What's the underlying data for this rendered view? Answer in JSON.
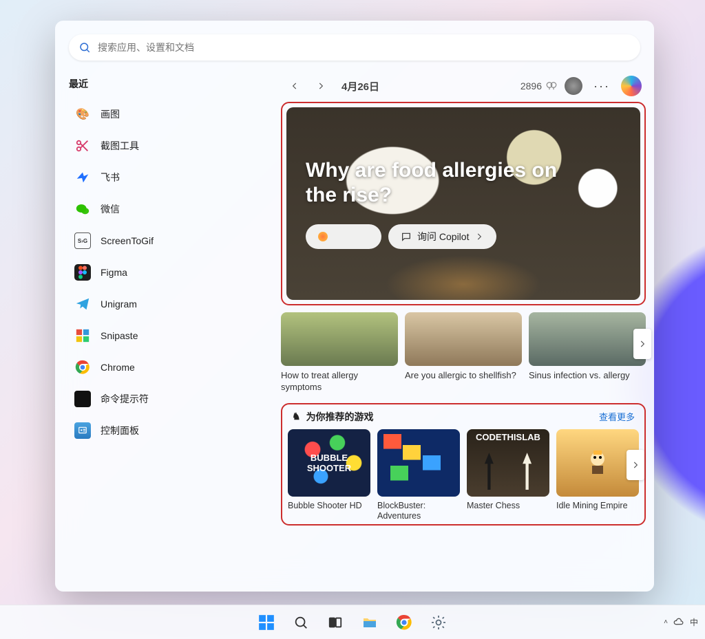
{
  "search": {
    "placeholder": "搜索应用、设置和文档"
  },
  "sidebar": {
    "section_title": "最近",
    "items": [
      {
        "label": "画图",
        "icon": "paint-icon"
      },
      {
        "label": "截图工具",
        "icon": "snip-icon"
      },
      {
        "label": "飞书",
        "icon": "feishu-icon"
      },
      {
        "label": "微信",
        "icon": "wechat-icon"
      },
      {
        "label": "ScreenToGif",
        "icon": "screentogif-icon"
      },
      {
        "label": "Figma",
        "icon": "figma-icon"
      },
      {
        "label": "Unigram",
        "icon": "unigram-icon"
      },
      {
        "label": "Snipaste",
        "icon": "snipaste-icon"
      },
      {
        "label": "Chrome",
        "icon": "chrome-icon"
      },
      {
        "label": "命令提示符",
        "icon": "cmd-icon"
      },
      {
        "label": "控制面板",
        "icon": "controlpanel-icon"
      }
    ]
  },
  "feed": {
    "date": "4月26日",
    "points": "2896",
    "hero": {
      "title": "Why are food allergies on the rise?",
      "ask_label": "询问 Copilot"
    },
    "articles": [
      {
        "label": "How to treat allergy symptoms"
      },
      {
        "label": "Are you allergic to shellfish?"
      },
      {
        "label": "Sinus infection vs. allergy"
      }
    ],
    "games_section": {
      "title": "为你推荐的游戏",
      "more": "查看更多",
      "games": [
        {
          "label": "Bubble Shooter HD",
          "thumb_text": "BUBBLE SHOOTER"
        },
        {
          "label": "BlockBuster: Adventures"
        },
        {
          "label": "Master Chess",
          "badge": "CODETHISLAB"
        },
        {
          "label": "Idle Mining Empire"
        }
      ]
    }
  },
  "taskbar": {
    "tray_lang": "中"
  }
}
